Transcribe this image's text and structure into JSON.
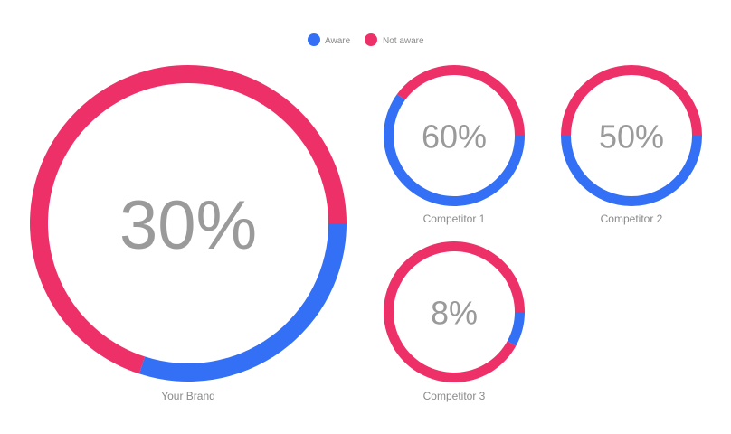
{
  "chart_data": {
    "type": "pie",
    "variant": "donut",
    "legend": {
      "position": "top-center",
      "entries": [
        {
          "key": "aware",
          "label": "Aware",
          "color": "#3370f5"
        },
        {
          "key": "not_aware",
          "label": "Not aware",
          "color": "#ee3068"
        }
      ]
    },
    "charts": [
      {
        "id": "your-brand",
        "name": "Your Brand",
        "aware_pct": 30,
        "not_aware_pct": 70,
        "label": "30%"
      },
      {
        "id": "competitor-1",
        "name": "Competitor 1",
        "aware_pct": 60,
        "not_aware_pct": 40,
        "label": "60%"
      },
      {
        "id": "competitor-2",
        "name": "Competitor 2",
        "aware_pct": 50,
        "not_aware_pct": 50,
        "label": "50%"
      },
      {
        "id": "competitor-3",
        "name": "Competitor 3",
        "aware_pct": 8,
        "not_aware_pct": 92,
        "label": "8%"
      }
    ]
  }
}
